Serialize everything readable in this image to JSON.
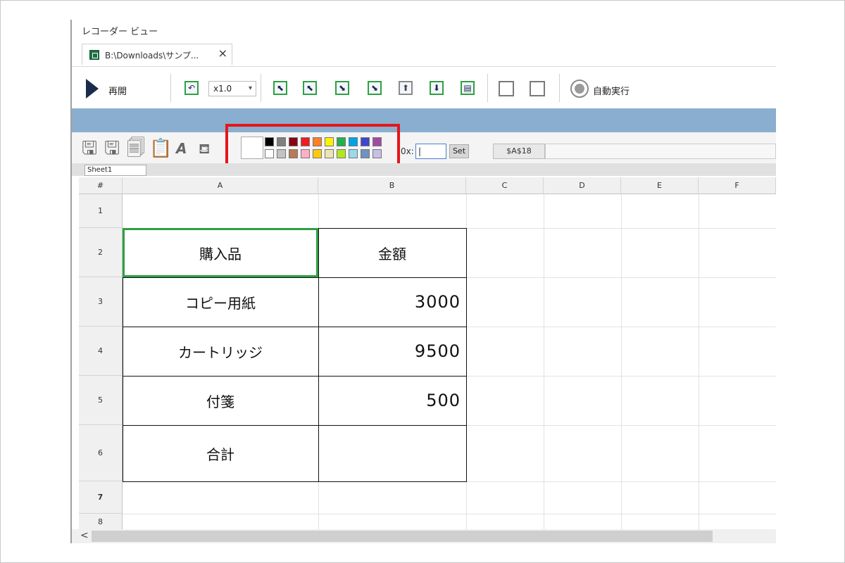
{
  "window": {
    "title": "レコーダー ビュー"
  },
  "tab": {
    "label": "B:\\Downloads\\サンプ...",
    "close": "×"
  },
  "toolbar": {
    "resume_label": "再開",
    "speed_value": "x1.0",
    "speed_caret": "▾",
    "auto_label": "自動実行",
    "nav_buttons": [
      {
        "icon": "arrow-up-left-icon",
        "glyph": "⬉"
      },
      {
        "icon": "arrow-up-left-alt-icon",
        "glyph": "⬉"
      },
      {
        "icon": "arrow-down-right-icon",
        "glyph": "⬊"
      },
      {
        "icon": "arrow-down-right-alt-icon",
        "glyph": "⬊"
      },
      {
        "icon": "arrow-up-icon",
        "glyph": "⬆"
      },
      {
        "icon": "arrow-down-icon",
        "glyph": "⬇"
      },
      {
        "icon": "clipboard-icon",
        "glyph": "▤"
      }
    ]
  },
  "palette": {
    "row1": [
      "#000000",
      "#7f7f7f",
      "#880015",
      "#ed1c24",
      "#ff7f27",
      "#fff200",
      "#22b14c",
      "#00a2e8",
      "#3f48cc",
      "#a349a4"
    ],
    "row2": [
      "#ffffff",
      "#c3c3c3",
      "#b97a57",
      "#ffaec9",
      "#ffc90e",
      "#efe4b0",
      "#b5e61d",
      "#99d9ea",
      "#7092be",
      "#c8bfe7"
    ],
    "ox_label": "0x:",
    "ox_value": "|",
    "set_label": "Set",
    "cell_ref": "$A$18"
  },
  "sheet": {
    "tab": "Sheet1"
  },
  "grid": {
    "corner": "#",
    "columns": [
      "A",
      "B",
      "C",
      "D",
      "E",
      "F"
    ],
    "rows": [
      "1",
      "2",
      "3",
      "4",
      "5",
      "6",
      "7",
      "8"
    ],
    "header_row": {
      "item": "購入品",
      "amount": "金額"
    },
    "items": [
      {
        "name": "コピー用紙",
        "amount": "3000"
      },
      {
        "name": "カートリッジ",
        "amount": "9500"
      },
      {
        "name": "付箋",
        "amount": "500"
      },
      {
        "name": "合計",
        "amount": ""
      }
    ]
  },
  "scroll": {
    "left_arrow": "<"
  }
}
